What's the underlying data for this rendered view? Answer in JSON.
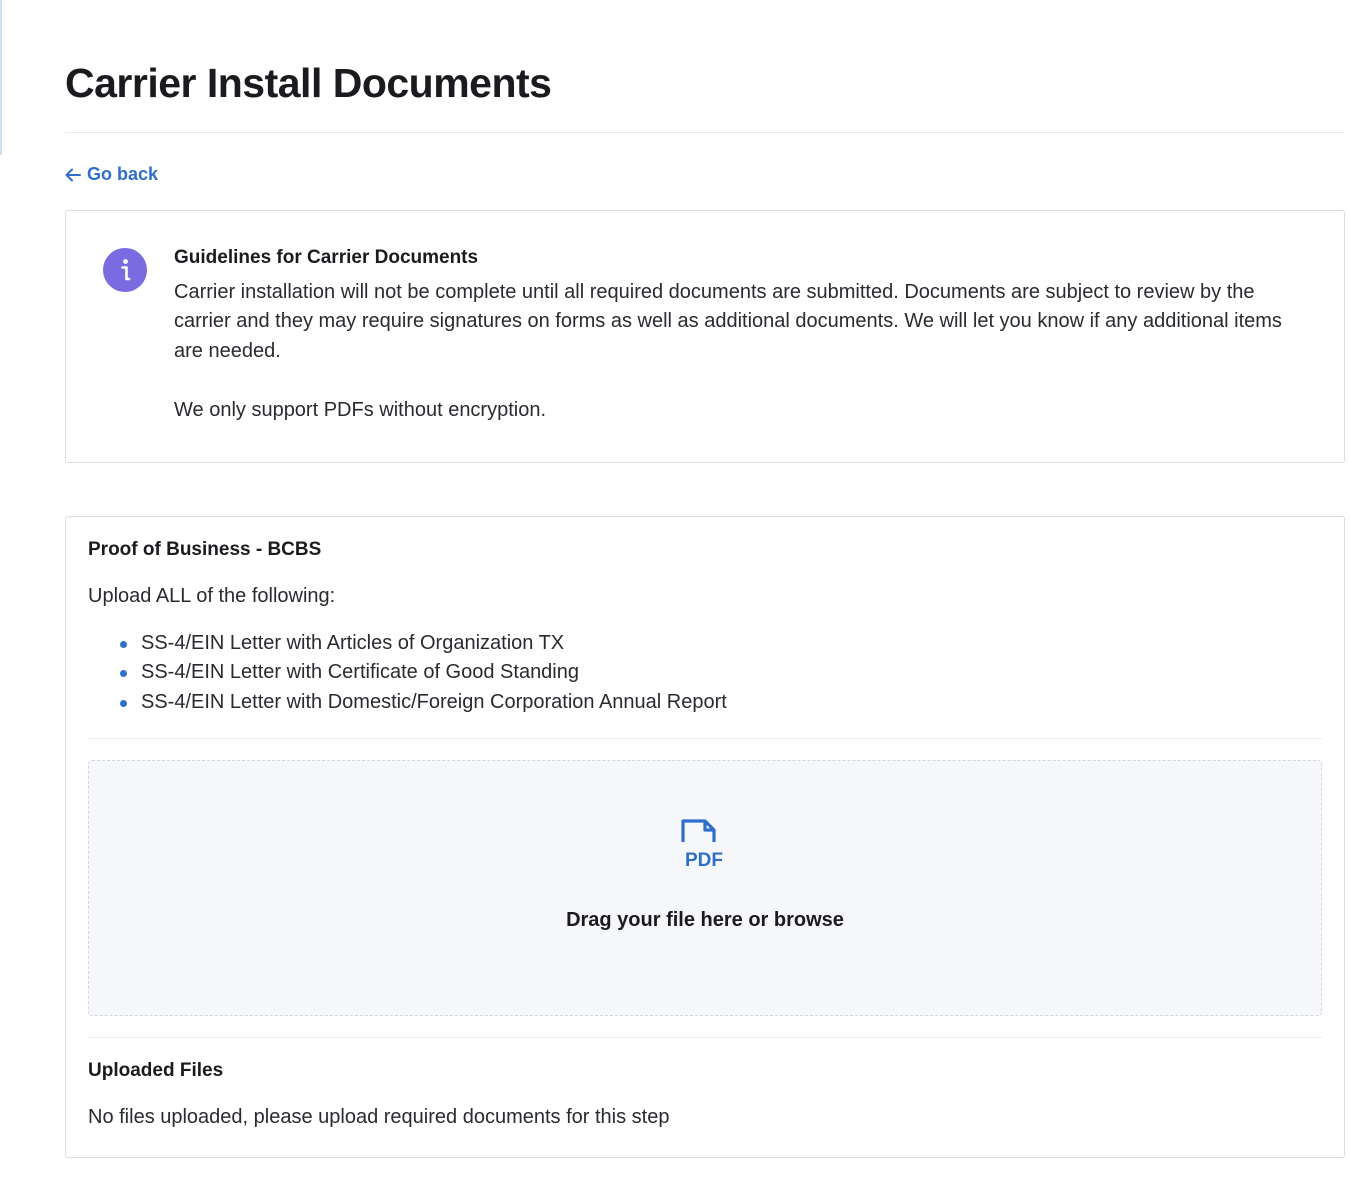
{
  "page": {
    "title": "Carrier Install Documents",
    "go_back_label": "Go back"
  },
  "guidelines": {
    "title": "Guidelines for Carrier Documents",
    "body": "Carrier installation will not be complete until all required documents are submitted. Documents are subject to review by the carrier and they may require signatures on forms as well as additional documents. We will let you know if any additional items are needed.",
    "note": "We only support PDFs without encryption.",
    "icon": "info-icon",
    "icon_color": "#7b6be0"
  },
  "document": {
    "title": "Proof of Business - BCBS",
    "instructions": "Upload ALL of the following:",
    "requirements": [
      "SS-4/EIN Letter with Articles of Organization TX",
      "SS-4/EIN Letter with Certificate of Good Standing",
      "SS-4/EIN Letter with Domestic/Foreign Corporation Annual Report"
    ],
    "dropzone_label": "Drag your file here or browse",
    "dropzone_icon": "pdf-file-icon",
    "uploaded_title": "Uploaded Files",
    "uploaded_empty": "No files uploaded, please upload required documents for this step"
  },
  "colors": {
    "accent": "#2f6fca",
    "info": "#7b6be0",
    "dropzone_bg": "#f5f7fa"
  }
}
